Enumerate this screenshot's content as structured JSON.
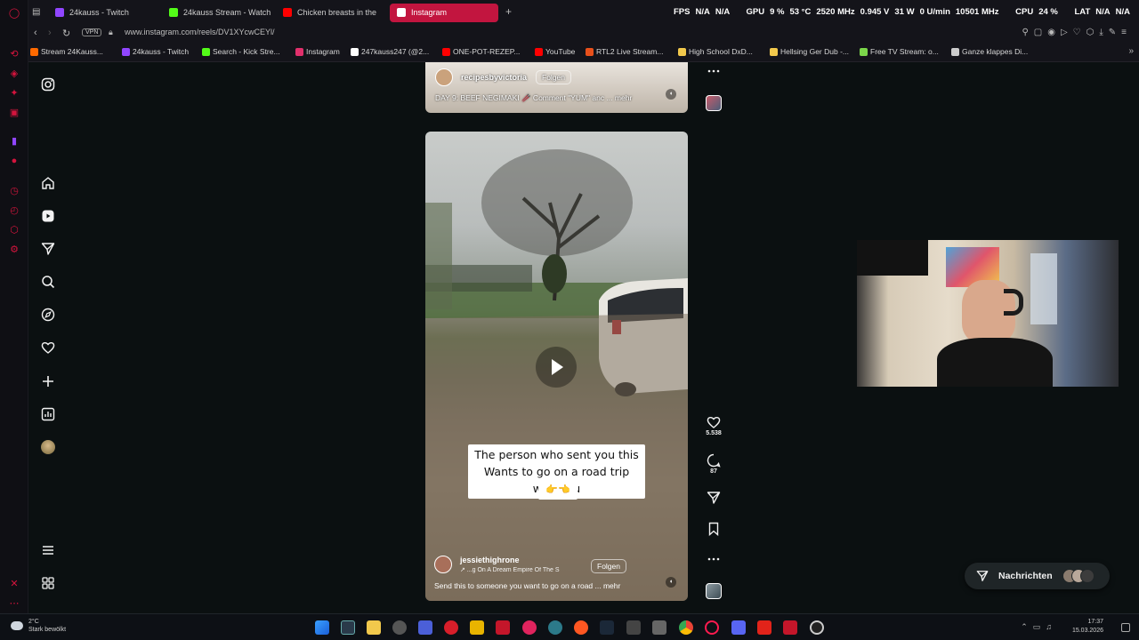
{
  "browser": {
    "tabs": [
      {
        "label": "24kauss - Twitch",
        "color": "#9146ff"
      },
      {
        "label": "24kauss Stream - Watch l",
        "color": "#53fc18"
      },
      {
        "label": "Chicken breasts in the",
        "color": "#ff0000"
      },
      {
        "label": "Instagram",
        "color": "#e1306c"
      }
    ],
    "hw_stats": [
      "FPS",
      "N/A",
      "N/A",
      "GPU",
      "9 %",
      "53 °C",
      "2520 MHz",
      "0.945 V",
      "31 W",
      "0 U/min",
      "10501 MHz",
      "CPU",
      "24 %",
      "LAT",
      "N/A",
      "N/A"
    ],
    "vpn": "VPN",
    "url": "www.instagram.com/reels/DV1XYcwCEYl/",
    "bookmarks": [
      {
        "label": "Stream 24Kauss...",
        "color": "#ff6a00"
      },
      {
        "label": "24kauss - Twitch",
        "color": "#9146ff"
      },
      {
        "label": "Search - Kick Stre...",
        "color": "#53fc18"
      },
      {
        "label": "Instagram",
        "color": "#e1306c"
      },
      {
        "label": "247kauss247 (@2...",
        "color": "#ffffff"
      },
      {
        "label": "ONE-POT-REZEP...",
        "color": "#ff0000"
      },
      {
        "label": "YouTube",
        "color": "#ff0000"
      },
      {
        "label": "RTL2 Live Stream...",
        "color": "#e8501b"
      },
      {
        "label": "High School DxD...",
        "color": "#f2c94c"
      },
      {
        "label": "Hellsing Ger Dub -...",
        "color": "#f2c94c"
      },
      {
        "label": "Free TV Stream: o...",
        "color": "#7bd64a"
      },
      {
        "label": "Ganze klappes Di...",
        "color": "#cccccc"
      }
    ]
  },
  "reel_top": {
    "username": "recipesbyvictoria",
    "follow": "Folgen",
    "caption": "DAY 9: BEEF NEGIMAKI 🥢 Comment \"YUM\" anc ... mehr"
  },
  "reel_main": {
    "overlay_line1": "The person who sent you this",
    "overlay_line2": "Wants to go on a road trip with you",
    "overlay_emoji": "👉👈",
    "username": "jessiethighrone",
    "audio": "↗ ...g On A Dream  Empire Of The S",
    "follow": "Folgen",
    "caption": "Send this to someone you want to go on a road  ... mehr"
  },
  "actions": {
    "likes": "5.538",
    "comments": "87"
  },
  "messages": {
    "label": "Nachrichten"
  },
  "taskbar": {
    "weather_temp": "2°C",
    "weather_desc": "Stark bewölkt",
    "time": "17:37",
    "date": "15.03.2026"
  },
  "colors": {
    "accent": "#c2153f",
    "background": "#0b1011"
  }
}
